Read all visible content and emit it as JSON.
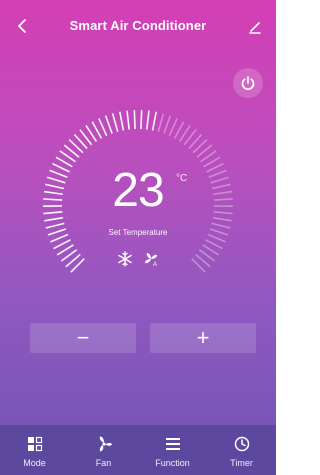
{
  "header": {
    "title": "Smart Air Conditioner"
  },
  "thermostat": {
    "temperature": "23",
    "unit": "°C",
    "label": "Set Temperature"
  },
  "controls": {
    "minus_label": "−",
    "plus_label": "+"
  },
  "tabs": [
    {
      "label": "Mode",
      "icon": "mode-grid-icon"
    },
    {
      "label": "Fan",
      "icon": "fan-icon"
    },
    {
      "label": "Function",
      "icon": "menu-icon"
    },
    {
      "label": "Timer",
      "icon": "clock-icon"
    }
  ],
  "colors": {
    "gradient_top": "#d43eb4",
    "gradient_bottom": "#6f54b2",
    "tabbar": "#5d489f",
    "foreground": "#ffffff"
  },
  "status_icons": [
    "snowflake-icon",
    "fan-auto-icon"
  ]
}
